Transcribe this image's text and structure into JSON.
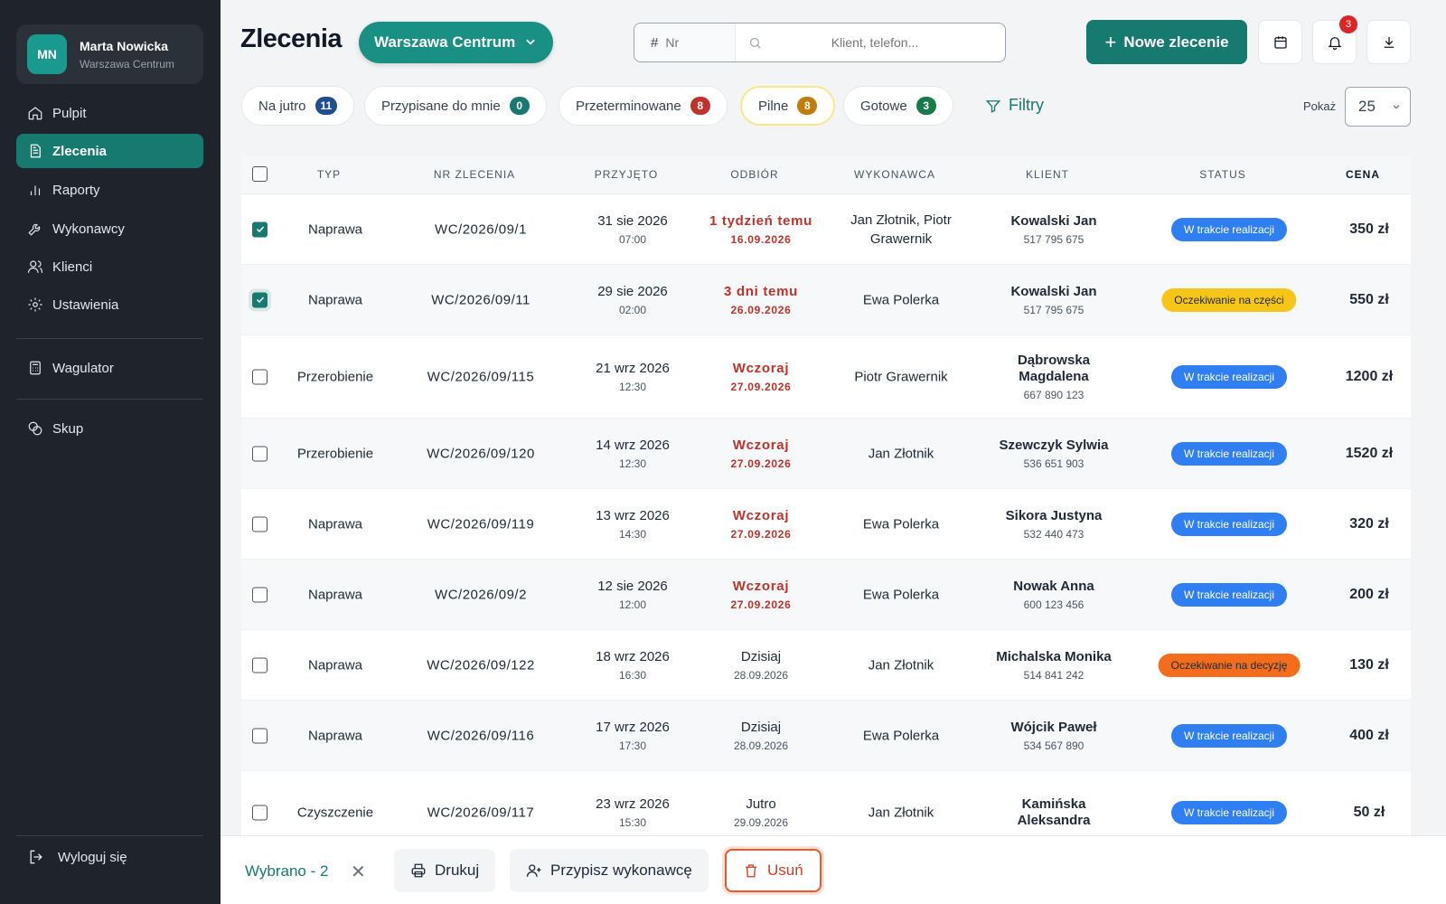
{
  "app": {
    "title": "Zlecenia"
  },
  "user": {
    "initials": "MN",
    "name": "Marta Nowicka",
    "location": "Warszawa Centrum"
  },
  "sidebar": {
    "items": [
      {
        "label": "Pulpit",
        "icon": "home-icon"
      },
      {
        "label": "Zlecenia",
        "icon": "document-icon",
        "active": true
      },
      {
        "label": "Raporty",
        "icon": "bar-chart-icon"
      },
      {
        "label": "Wykonawcy",
        "icon": "wrench-icon"
      },
      {
        "label": "Klienci",
        "icon": "users-icon"
      },
      {
        "label": "Ustawienia",
        "icon": "gear-icon"
      },
      {
        "label": "Wagulator",
        "icon": "calculator-icon"
      },
      {
        "label": "Skup",
        "icon": "coins-icon"
      }
    ],
    "logout": "Wyloguj się"
  },
  "header": {
    "location": "Warszawa Centrum",
    "search_nr_placeholder": "Nr",
    "search_nr_prefix": "#",
    "search_client_placeholder": "Klient, telefon...",
    "new_order": "Nowe zlecenie",
    "notifications_count": "3"
  },
  "filters": {
    "chips": [
      {
        "label": "Na jutro",
        "count": "11",
        "color": "#1d4f91"
      },
      {
        "label": "Przypisane do mnie",
        "count": "0",
        "color": "#167a70"
      },
      {
        "label": "Przeterminowane",
        "count": "8",
        "color": "#c0322b"
      },
      {
        "label": "Pilne",
        "count": "8",
        "color": "#c27c0e"
      },
      {
        "label": "Gotowe",
        "count": "3",
        "color": "#167a4a"
      }
    ],
    "filters_label": "Filtry",
    "show_label": "Pokaż",
    "show_value": "25"
  },
  "table": {
    "headers": [
      "TYP",
      "NR ZLECENIA",
      "PRZYJĘTO",
      "ODBIÓR",
      "WYKONAWCA",
      "KLIENT",
      "STATUS",
      "CENA"
    ],
    "rows": [
      {
        "checked": true,
        "type": "Naprawa",
        "nr": "WC/2026/09/1",
        "received": "31 sie 2026",
        "received_time": "07:00",
        "pickup": "1 tydzień temu",
        "pickup_date": "16.09.2026",
        "overdue": true,
        "worker": "Jan Złotnik, Piotr Grawernik",
        "client": "Kowalski Jan",
        "phone": "517 795 675",
        "status": "W trakcie realizacji",
        "status_color": "blue",
        "price": "350 zł"
      },
      {
        "checked": true,
        "type": "Naprawa",
        "nr": "WC/2026/09/11",
        "received": "29 sie 2026",
        "received_time": "02:00",
        "pickup": "3 dni temu",
        "pickup_date": "26.09.2026",
        "overdue": true,
        "worker": "Ewa Polerka",
        "client": "Kowalski Jan",
        "phone": "517 795 675",
        "status": "Oczekiwanie na części",
        "status_color": "yellow",
        "price": "550 zł"
      },
      {
        "checked": false,
        "type": "Przerobienie",
        "nr": "WC/2026/09/115",
        "received": "21 wrz 2026",
        "received_time": "12:30",
        "pickup": "Wczoraj",
        "pickup_date": "27.09.2026",
        "overdue": true,
        "worker": "Piotr Grawernik",
        "client": "Dąbrowska Magdalena",
        "phone": "667 890 123",
        "status": "W trakcie realizacji",
        "status_color": "blue",
        "price": "1200 zł"
      },
      {
        "checked": false,
        "type": "Przerobienie",
        "nr": "WC/2026/09/120",
        "received": "14 wrz 2026",
        "received_time": "12:30",
        "pickup": "Wczoraj",
        "pickup_date": "27.09.2026",
        "overdue": true,
        "worker": "Jan Złotnik",
        "client": "Szewczyk Sylwia",
        "phone": "536 651 903",
        "status": "W trakcie realizacji",
        "status_color": "blue",
        "price": "1520 zł"
      },
      {
        "checked": false,
        "type": "Naprawa",
        "nr": "WC/2026/09/119",
        "received": "13 wrz 2026",
        "received_time": "14:30",
        "pickup": "Wczoraj",
        "pickup_date": "27.09.2026",
        "overdue": true,
        "worker": "Ewa Polerka",
        "client": "Sikora Justyna",
        "phone": "532 440 473",
        "status": "W trakcie realizacji",
        "status_color": "blue",
        "price": "320 zł"
      },
      {
        "checked": false,
        "type": "Naprawa",
        "nr": "WC/2026/09/2",
        "received": "12 sie 2026",
        "received_time": "12:00",
        "pickup": "Wczoraj",
        "pickup_date": "27.09.2026",
        "overdue": true,
        "worker": "Ewa Polerka",
        "client": "Nowak Anna",
        "phone": "600 123 456",
        "status": "W trakcie realizacji",
        "status_color": "blue",
        "price": "200 zł"
      },
      {
        "checked": false,
        "type": "Naprawa",
        "nr": "WC/2026/09/122",
        "received": "18 wrz 2026",
        "received_time": "16:30",
        "pickup": "Dzisiaj",
        "pickup_date": "28.09.2026",
        "overdue": false,
        "worker": "Jan Złotnik",
        "client": "Michalska Monika",
        "phone": "514 841 242",
        "status": "Oczekiwanie na decyzję",
        "status_color": "orange",
        "price": "130 zł"
      },
      {
        "checked": false,
        "type": "Naprawa",
        "nr": "WC/2026/09/116",
        "received": "17 wrz 2026",
        "received_time": "17:30",
        "pickup": "Dzisiaj",
        "pickup_date": "28.09.2026",
        "overdue": false,
        "worker": "Ewa Polerka",
        "client": "Wójcik Paweł",
        "phone": "534 567 890",
        "status": "W trakcie realizacji",
        "status_color": "blue",
        "price": "400 zł"
      },
      {
        "checked": false,
        "type": "Czyszczenie",
        "nr": "WC/2026/09/117",
        "received": "23 wrz 2026",
        "received_time": "15:30",
        "pickup": "Jutro",
        "pickup_date": "29.09.2026",
        "overdue": false,
        "worker": "Jan Złotnik",
        "client": "Kamińska Aleksandra",
        "phone": "",
        "status": "W trakcie realizacji",
        "status_color": "blue",
        "price": "50 zł"
      }
    ]
  },
  "bottom_bar": {
    "selected": "Wybrano - 2",
    "print": "Drukuj",
    "assign": "Przypisz wykonawcę",
    "delete": "Usuń"
  },
  "colors": {
    "accent": "#167a70",
    "sidebar": "#1f242c",
    "overdue": "#c0322b"
  }
}
